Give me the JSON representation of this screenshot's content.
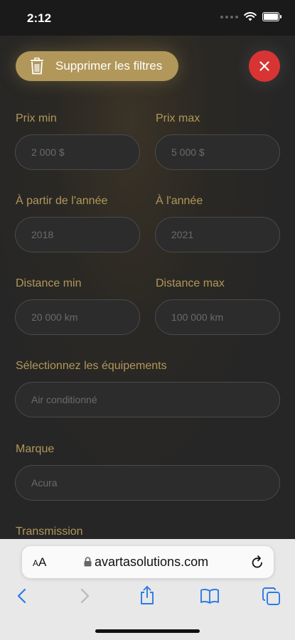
{
  "status_bar": {
    "time": "2:12"
  },
  "filters": {
    "clear_label": "Supprimer les filtres",
    "fields": {
      "price_min": {
        "label": "Prix min",
        "placeholder": "2 000 $"
      },
      "price_max": {
        "label": "Prix max",
        "placeholder": "5 000 $"
      },
      "year_from": {
        "label": "À partir de l'année",
        "placeholder": "2018"
      },
      "year_to": {
        "label": "À l'année",
        "placeholder": "2021"
      },
      "distance_min": {
        "label": "Distance min",
        "placeholder": "20 000 km"
      },
      "distance_max": {
        "label": "Distance max",
        "placeholder": "100 000 km"
      },
      "equipment": {
        "label": "Sélectionnez les équipements",
        "placeholder": "Air conditionné"
      },
      "brand": {
        "label": "Marque",
        "placeholder": "Acura"
      },
      "transmission": {
        "label": "Transmission"
      }
    }
  },
  "browser": {
    "text_size": "AA",
    "url": "avartasolutions.com"
  },
  "colors": {
    "accent": "#b2975a",
    "close": "#d83434",
    "background": "#262626",
    "browser_tint": "#2a7ae4"
  },
  "icons": [
    "trash-icon",
    "close-icon",
    "wifi-icon",
    "battery-icon",
    "lock-icon",
    "reload-icon",
    "back-icon",
    "forward-icon",
    "share-icon",
    "bookmarks-icon",
    "tabs-icon"
  ]
}
